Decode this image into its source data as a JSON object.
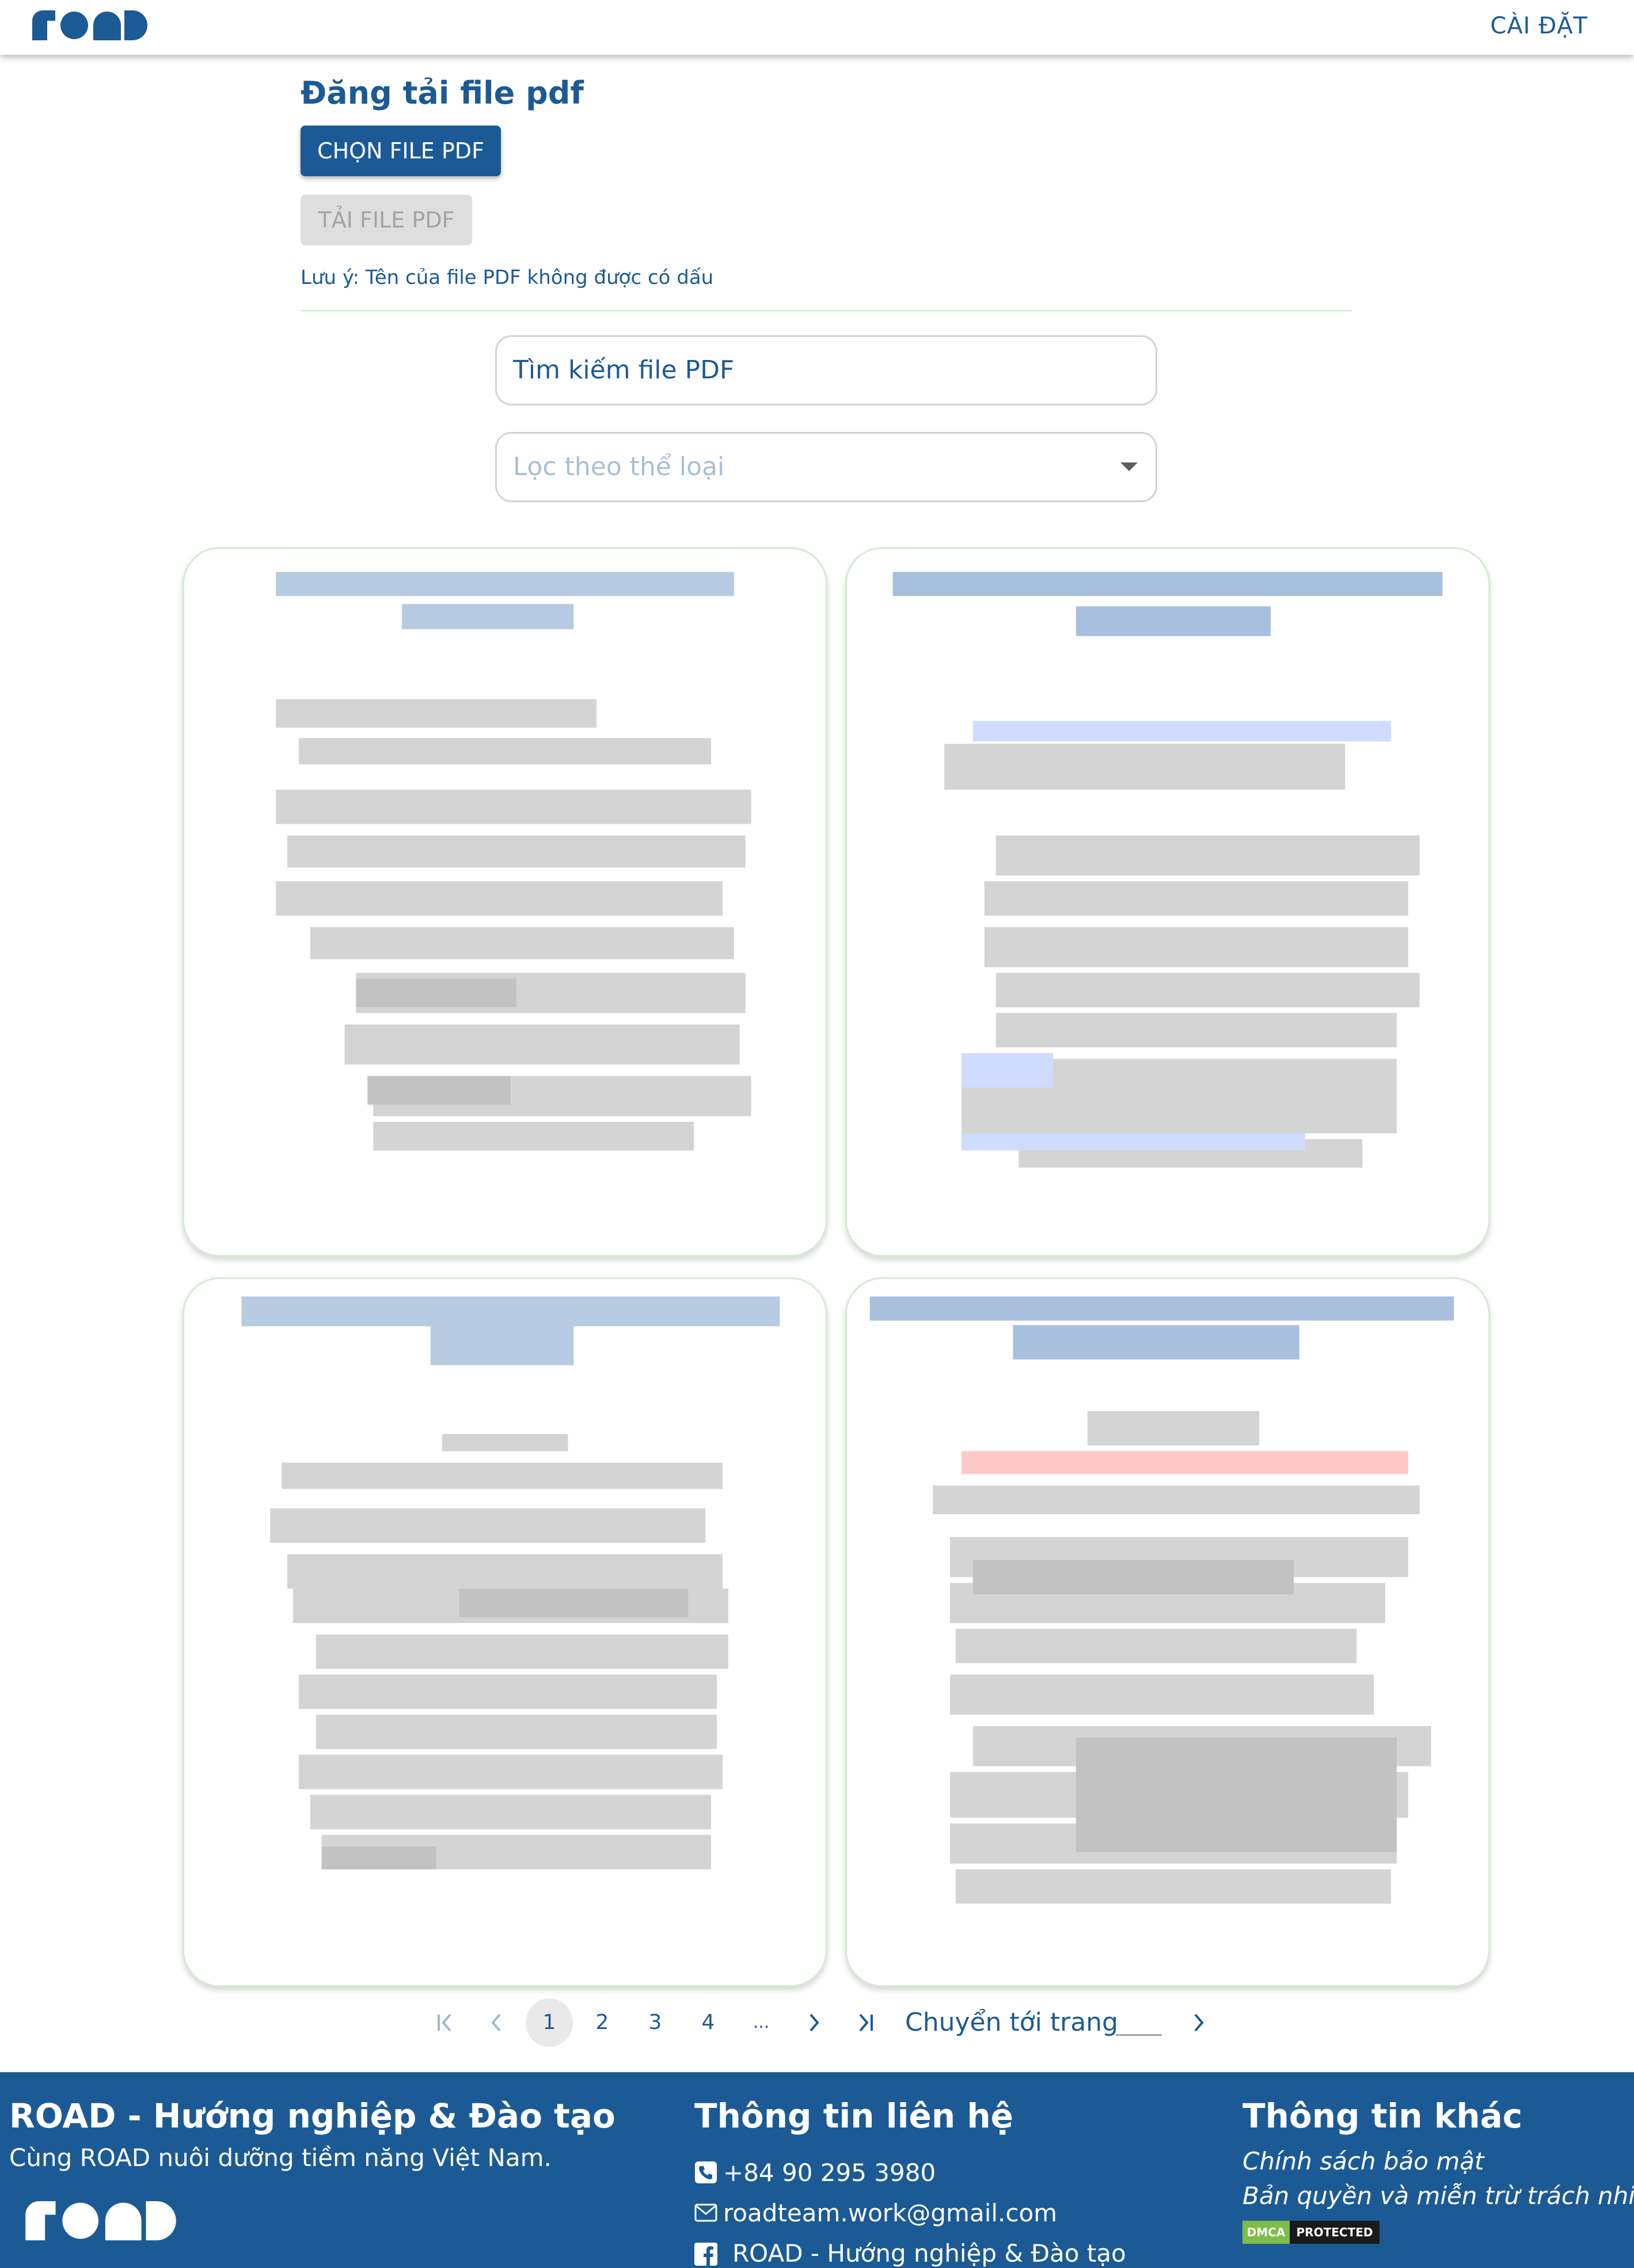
{
  "header": {
    "logo": "road",
    "settings_label": "CÀI ĐẶT"
  },
  "upload": {
    "title": "Đăng tải file pdf",
    "choose_label": "CHỌN FILE PDF",
    "upload_label": "TẢI FILE PDF",
    "note": "Lưu ý: Tên của file PDF không được có dấu"
  },
  "search": {
    "value": "Tìm kiếm file PDF"
  },
  "filter": {
    "placeholder": "Lọc theo thể loại",
    "icon": "caret-down-icon"
  },
  "cards": [
    {
      "thumb_accent": "#b7cbe2",
      "highlight": ""
    },
    {
      "thumb_accent": "#a8c0de",
      "highlight": "#cfdcff"
    },
    {
      "thumb_accent": "#b7cbe2",
      "highlight": ""
    },
    {
      "thumb_accent": "#a8c0de",
      "highlight": "#ffc9c9"
    }
  ],
  "pagination": {
    "first_icon": "first-page-icon",
    "prev_icon": "prev-page-icon",
    "pages": [
      "1",
      "2",
      "3",
      "4",
      "..."
    ],
    "current": "1",
    "next_icon": "next-page-icon",
    "last_icon": "last-page-icon",
    "jump_label": "Chuyển tới trang",
    "go_icon": "go-page-icon"
  },
  "footer": {
    "brand_title": "ROAD - Hướng nghiệp & Đào tạo",
    "brand_tagline": "Cùng ROAD nuôi dưỡng tiềm năng Việt Nam.",
    "contact_title": "Thông tin liên hệ",
    "phone": "+84 90 295 3980",
    "email": "roadteam.work@gmail.com",
    "facebook": "ROAD - Hướng nghiệp & Đào tạo",
    "other_title": "Thông tin khác",
    "privacy": "Chính sách bảo mật",
    "copyright": "Bản quyền và miễn trừ trách nhiệm",
    "dmca_left": "DMCA",
    "dmca_right": "PROTECTED"
  },
  "colors": {
    "brand": "#1c5a95",
    "card_border": "#d6ead3",
    "dmca_green": "#7fbc48"
  }
}
